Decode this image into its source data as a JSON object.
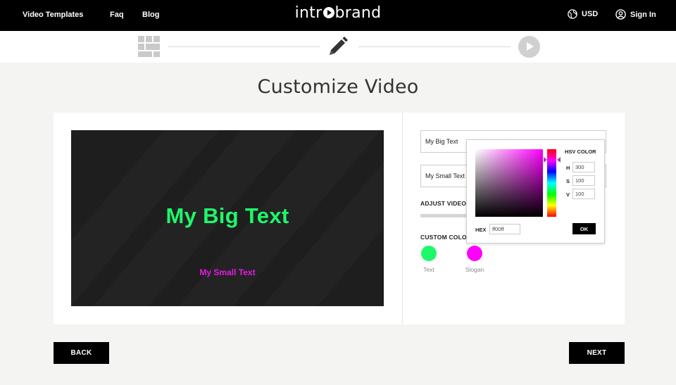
{
  "header": {
    "nav": [
      {
        "label": "Video Templates"
      },
      {
        "label": "Faq"
      },
      {
        "label": "Blog"
      }
    ],
    "logo_pre": "intr",
    "logo_post": "brand",
    "currency": "USD",
    "sign_in": "Sign In"
  },
  "page": {
    "title": "Customize Video"
  },
  "preview": {
    "big_text": "My Big Text",
    "small_text": "My Small Text"
  },
  "form": {
    "big_text_value": "My Big Text",
    "small_text_value": "My Small Text",
    "adjust_label": "ADJUST VIDEO",
    "colors_label": "CUSTOM COLO",
    "swatches": [
      {
        "label": "Text",
        "color": "#1ef86a"
      },
      {
        "label": "Slogan",
        "color": "#ff00ff"
      }
    ]
  },
  "picker": {
    "title": "HSV COLOR",
    "h_label": "H",
    "h_value": "300",
    "s_label": "S",
    "s_value": "100",
    "v_label": "V",
    "v_value": "100",
    "hex_label": "HEX",
    "hex_value": "ff00ff",
    "ok_label": "OK"
  },
  "footer": {
    "back_label": "BACK",
    "next_label": "NEXT"
  },
  "colors": {
    "accent_green": "#1ef86a",
    "accent_magenta": "#e51be5",
    "dark": "#000000"
  }
}
